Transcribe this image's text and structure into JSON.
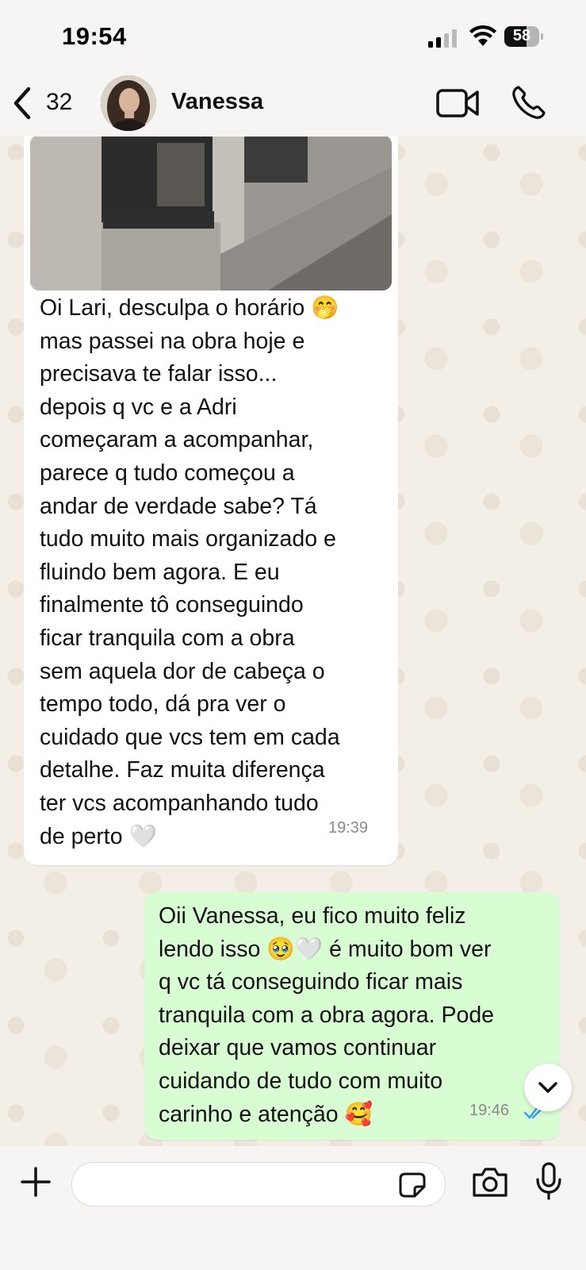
{
  "status_bar": {
    "time": "19:54",
    "battery": "58"
  },
  "header": {
    "back_count": "32",
    "contact_name": "Vanessa"
  },
  "incoming": {
    "text": "Oi Lari, desculpa o horário 🤭\nmas passei na obra hoje e\nprecisava te falar isso...\ndepois q vc e a Adri\ncomeçaram a acompanhar,\nparece q tudo começou a\nandar de verdade sabe? Tá\ntudo muito mais organizado e\nfluindo bem agora. E eu\nfinalmente tô conseguindo\nficar tranquila com a obra\nsem aquela dor de cabeça o\ntempo todo, dá pra ver o\ncuidado que vcs tem em cada\ndetalhe. Faz muita diferença\nter vcs acompanhando tudo\nde perto 🤍",
    "time": "19:39"
  },
  "outgoing": {
    "text": "Oii Vanessa, eu fico muito feliz\nlendo isso 🥹🤍 é muito bom ver\nq vc tá conseguindo ficar mais\ntranquila com a obra agora. Pode\ndeixar que vamos continuar\ncuidando de tudo com muito\ncarinho e atenção 🥰",
    "time": "19:46"
  },
  "input": {
    "value": "",
    "placeholder": ""
  },
  "colors": {
    "outgoing_bubble": "#d9fdd3",
    "incoming_bubble": "#ffffff",
    "read_ticks": "#3c9af0"
  },
  "icons": [
    "back-chevron-icon",
    "video-call-icon",
    "phone-icon",
    "plus-icon",
    "sticker-icon",
    "camera-icon",
    "mic-icon",
    "chevron-down-icon",
    "double-check-icon"
  ]
}
